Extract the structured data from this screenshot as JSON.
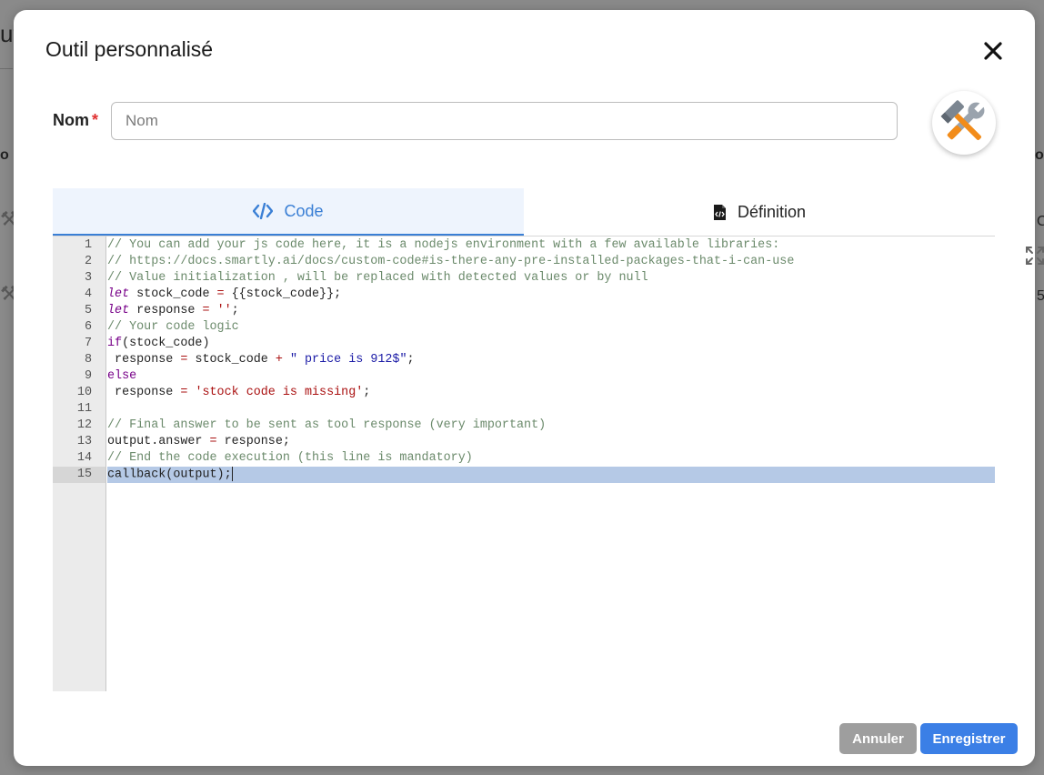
{
  "background": {
    "fragments": [
      "ut",
      "o",
      "o",
      "C",
      "5"
    ]
  },
  "modal": {
    "title": "Outil personnalisé",
    "close_icon": "close-icon",
    "name_label": "Nom",
    "required_marker": "*",
    "name_placeholder": "Nom",
    "name_value": "",
    "avatar_icon": "tools-icon"
  },
  "tabs": [
    {
      "label": "Code",
      "icon": "code-icon",
      "active": true
    },
    {
      "label": "Définition",
      "icon": "file-code-icon",
      "active": false
    }
  ],
  "editor": {
    "active_line": 15,
    "expand_icon": "expand-icon",
    "line_numbers": [
      "1",
      "2",
      "3",
      "4",
      "5",
      "6",
      "7",
      "8",
      "9",
      "10",
      "11",
      "12",
      "13",
      "14",
      "15"
    ]
  },
  "buttons": {
    "cancel": "Annuler",
    "save": "Enregistrer"
  },
  "colors": {
    "accent": "#3a7fd5",
    "save_button": "#3b7fe6",
    "cancel_button": "#9e9e9e",
    "active_line": "#b5c9e6",
    "required": "#e03131"
  }
}
